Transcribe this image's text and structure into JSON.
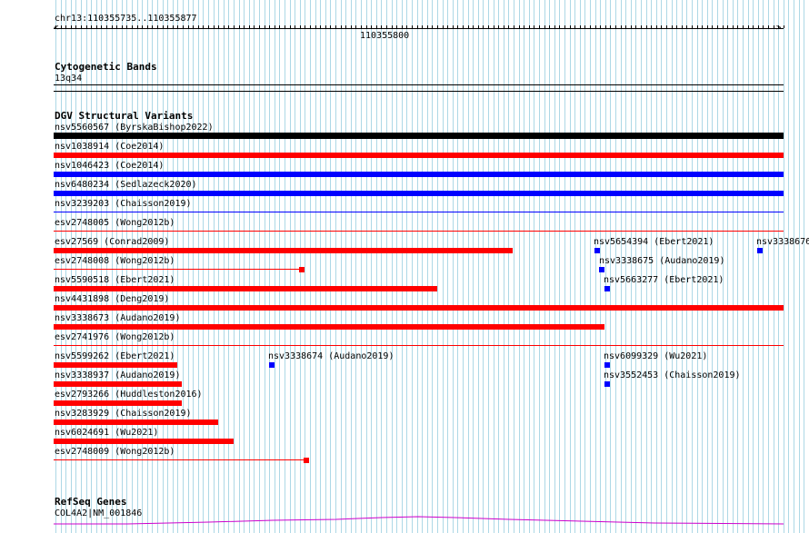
{
  "ruler": {
    "location": "chr13:110355735..110355877",
    "center_label": "110355800"
  },
  "colors": {
    "grid": "#add8e6",
    "red": "#ff0000",
    "blue": "#0000ff",
    "black": "#000000",
    "gene": "#cc00cc"
  },
  "cytoband": {
    "title": "Cytogenetic Bands",
    "band": "13q34"
  },
  "dgv": {
    "title": "DGV Structural Variants",
    "features": [
      {
        "label": "nsv5560567 (ByrskaBishop2022)",
        "color": "black"
      },
      {
        "label": "nsv1038914 (Coe2014)",
        "color": "red"
      },
      {
        "label": "nsv1046423 (Coe2014)",
        "color": "blue"
      },
      {
        "label": "nsv6480234 (Sedlazeck2020)",
        "color": "blue"
      },
      {
        "label": "nsv3239203 (Chaisson2019)",
        "color": "blue"
      },
      {
        "label": "esv2748005 (Wong2012b)",
        "color": "red"
      },
      {
        "label": "esv27569 (Conrad2009)",
        "color": "red"
      },
      {
        "label": "esv2748008 (Wong2012b)",
        "color": "red"
      },
      {
        "label": "nsv5590518 (Ebert2021)",
        "color": "red"
      },
      {
        "label": "nsv4431898 (Deng2019)",
        "color": "red"
      },
      {
        "label": "nsv3338673 (Audano2019)",
        "color": "red"
      },
      {
        "label": "esv2741976 (Wong2012b)",
        "color": "red"
      },
      {
        "label": "nsv5599262 (Ebert2021)",
        "color": "red"
      },
      {
        "label": "nsv3338937 (Audano2019)",
        "color": "red"
      },
      {
        "label": "esv2793266 (Huddleston2016)",
        "color": "red"
      },
      {
        "label": "nsv3283929 (Chaisson2019)",
        "color": "red"
      },
      {
        "label": "nsv6024691 (Wu2021)",
        "color": "red"
      },
      {
        "label": "esv2748009 (Wong2012b)",
        "color": "red"
      },
      {
        "label": "nsv5654394 (Ebert2021)",
        "color": "blue"
      },
      {
        "label": "nsv3338676",
        "color": "blue"
      },
      {
        "label": "nsv3338675 (Audano2019)",
        "color": "blue"
      },
      {
        "label": "nsv5663277 (Ebert2021)",
        "color": "blue"
      },
      {
        "label": "nsv3338674 (Audano2019)",
        "color": "blue"
      },
      {
        "label": "nsv6099329 (Wu2021)",
        "color": "blue"
      },
      {
        "label": "nsv3552453 (Chaisson2019)",
        "color": "blue"
      }
    ]
  },
  "refseq": {
    "title": "RefSeq Genes",
    "gene_label": "COL4A2|NM_001846"
  }
}
